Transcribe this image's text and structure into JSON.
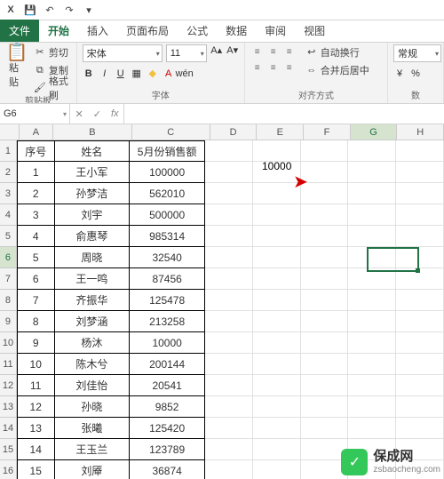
{
  "qat": {
    "save": "💾",
    "undo": "↶",
    "redo": "↷",
    "more": "▾"
  },
  "tabs": {
    "file": "文件",
    "home": "开始",
    "insert": "插入",
    "layout": "页面布局",
    "formula": "公式",
    "data": "数据",
    "review": "审阅",
    "view": "视图"
  },
  "ribbon": {
    "clipboard": {
      "paste": "粘贴",
      "cut": "剪切",
      "copy": "复制",
      "format_painter": "格式刷",
      "label": "剪贴板"
    },
    "font": {
      "name": "宋体",
      "size": "11",
      "label": "字体",
      "bold": "B",
      "italic": "I",
      "underline": "U"
    },
    "align": {
      "wrap": "自动换行",
      "merge": "合并后居中",
      "label": "对齐方式"
    },
    "number": {
      "general": "常规",
      "label": "数"
    }
  },
  "namebox": "G6",
  "formula": "",
  "columns": [
    "A",
    "B",
    "C",
    "D",
    "E",
    "F",
    "G",
    "H"
  ],
  "headers": {
    "a": "序号",
    "b": "姓名",
    "c": "5月份销售额"
  },
  "rows": [
    {
      "a": "1",
      "b": "王小军",
      "c": "100000"
    },
    {
      "a": "2",
      "b": "孙梦洁",
      "c": "562010"
    },
    {
      "a": "3",
      "b": "刘宇",
      "c": "500000"
    },
    {
      "a": "4",
      "b": "俞惠琴",
      "c": "985314"
    },
    {
      "a": "5",
      "b": "周晓",
      "c": "32540"
    },
    {
      "a": "6",
      "b": "王一鸣",
      "c": "87456"
    },
    {
      "a": "7",
      "b": "齐振华",
      "c": "125478"
    },
    {
      "a": "8",
      "b": "刘梦涵",
      "c": "213258"
    },
    {
      "a": "9",
      "b": "杨沐",
      "c": "10000"
    },
    {
      "a": "10",
      "b": "陈木兮",
      "c": "200144"
    },
    {
      "a": "11",
      "b": "刘佳怡",
      "c": "20541"
    },
    {
      "a": "12",
      "b": "孙晓",
      "c": "9852"
    },
    {
      "a": "13",
      "b": "张曦",
      "c": "125420"
    },
    {
      "a": "14",
      "b": "王玉兰",
      "c": "123789"
    },
    {
      "a": "15",
      "b": "刘厣",
      "c": "36874"
    }
  ],
  "floating": "10000",
  "watermark": {
    "cn": "保成网",
    "url": "zsbaocheng.com",
    "check": "✓"
  }
}
